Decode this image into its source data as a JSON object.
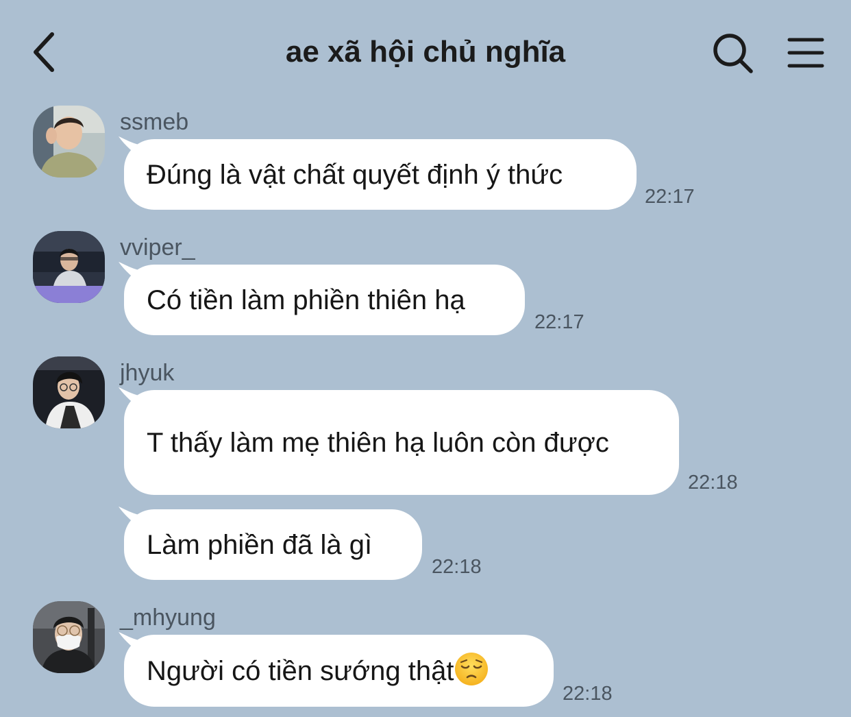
{
  "header": {
    "title": "ae xã hội chủ nghĩa",
    "back_icon": "chevron-left-icon",
    "search_icon": "search-icon",
    "menu_icon": "hamburger-menu-icon"
  },
  "colors": {
    "background": "#acbfd1",
    "bubble": "#ffffff",
    "text": "#161616",
    "meta": "#4a5560"
  },
  "messages": [
    {
      "sender": "ssmeb",
      "text": "Đúng là vật chất quyết định ý thức",
      "time": "22:17"
    },
    {
      "sender": "vviper_",
      "text": "Có tiền làm phiền thiên hạ",
      "time": "22:17"
    },
    {
      "sender": "jhyuk",
      "text": "T thấy làm mẹ thiên hạ luôn còn được",
      "time": "22:18"
    },
    {
      "sender": "",
      "text": "Làm phiền đã là gì",
      "time": "22:18"
    },
    {
      "sender": "_mhyung",
      "text": "Người có tiền sướng thật",
      "emoji": "pensive-face-emoji",
      "time": "22:18"
    }
  ]
}
